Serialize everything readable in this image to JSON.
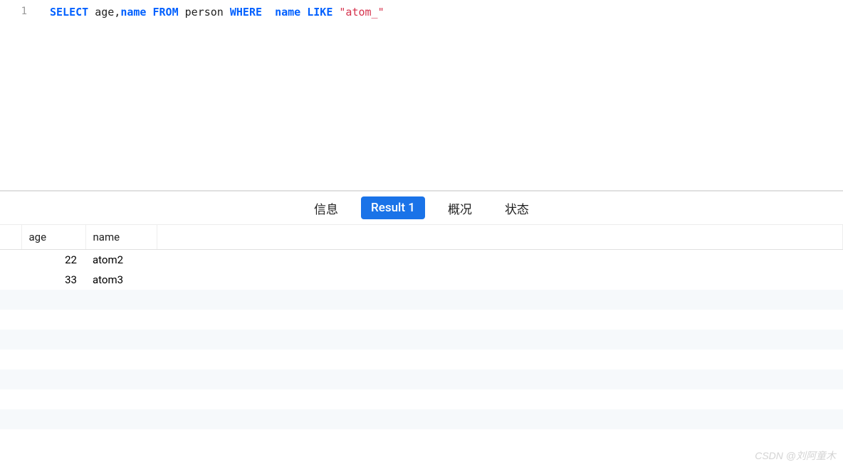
{
  "editor": {
    "line_number": "1",
    "sql": {
      "kw_select": "SELECT",
      "col_age": " age,",
      "col_name": "name",
      "kw_from": " FROM",
      "tbl": " person ",
      "kw_where": "WHERE",
      "col_name2": "name",
      "kw_like": " LIKE",
      "str_val": " \"atom_\""
    }
  },
  "tabs": {
    "info": "信息",
    "result": "Result 1",
    "overview": "概况",
    "status": "状态"
  },
  "result": {
    "columns": {
      "age": "age",
      "name": "name"
    },
    "rows": [
      {
        "age": "22",
        "name": "atom2"
      },
      {
        "age": "33",
        "name": "atom3"
      }
    ]
  },
  "watermark": "CSDN @刘阿童木"
}
